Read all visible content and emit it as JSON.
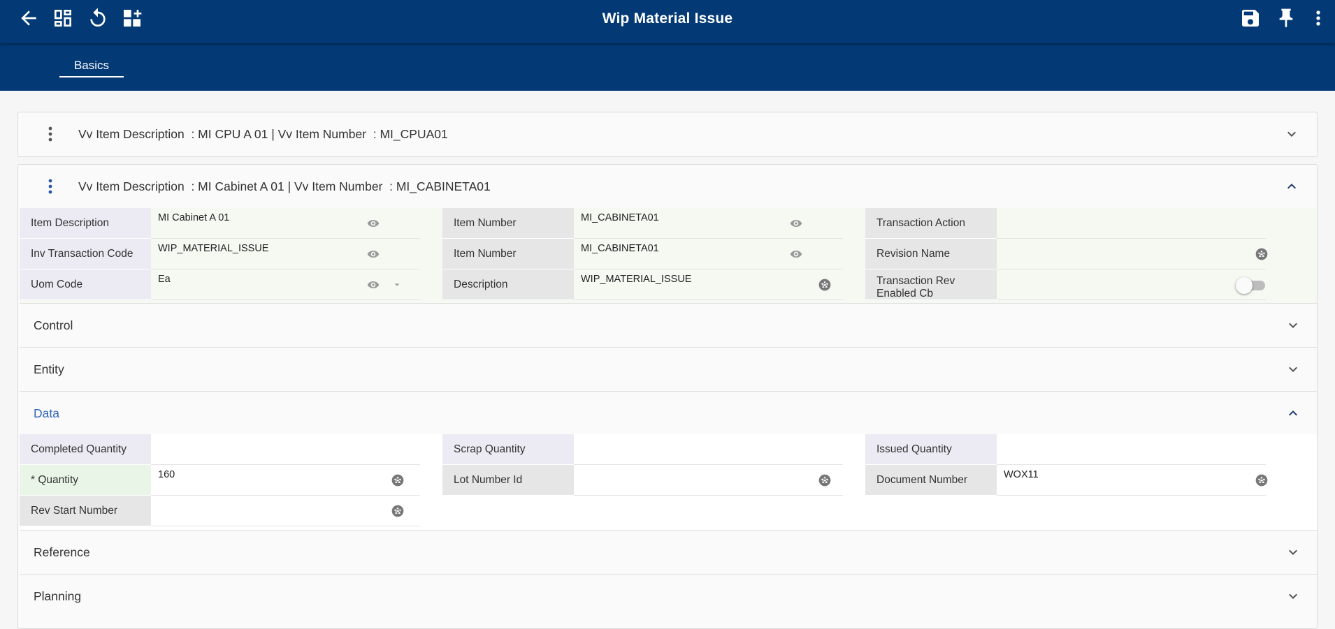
{
  "header": {
    "title": "Wip Material Issue",
    "tab_label": "Basics"
  },
  "panel1": {
    "title": "Vv Item Description  : MI CPU A 01 | Vv Item Number  : MI_CPUA01"
  },
  "panel2": {
    "title": "Vv Item Description  : MI Cabinet A 01 | Vv Item Number  : MI_CABINETA01",
    "fields": {
      "item_description": {
        "label": "Item Description",
        "value": "MI Cabinet A 01"
      },
      "inv_transaction_code": {
        "label": "Inv Transaction Code",
        "value": "WIP_MATERIAL_ISSUE"
      },
      "uom_code": {
        "label": "Uom Code",
        "value": "Ea"
      },
      "item_number_1": {
        "label": "Item Number",
        "value": "MI_CABINETA01"
      },
      "item_number_2": {
        "label": "Item Number",
        "value": "MI_CABINETA01"
      },
      "description": {
        "label": "Description",
        "value": "WIP_MATERIAL_ISSUE"
      },
      "transaction_action": {
        "label": "Transaction Action",
        "value": ""
      },
      "revision_name": {
        "label": "Revision Name",
        "value": ""
      },
      "transaction_rev_enabled": {
        "label": "Transaction Rev Enabled Cb",
        "value": false
      }
    }
  },
  "sections": {
    "control": "Control",
    "entity": "Entity",
    "data": "Data",
    "reference": "Reference",
    "planning": "Planning"
  },
  "data_section": {
    "completed_quantity": {
      "label": "Completed Quantity",
      "value": ""
    },
    "quantity": {
      "label": "* Quantity",
      "value": "160"
    },
    "rev_start_number": {
      "label": "Rev Start Number",
      "value": ""
    },
    "scrap_quantity": {
      "label": "Scrap Quantity",
      "value": ""
    },
    "lot_number_id": {
      "label": "Lot Number Id",
      "value": ""
    },
    "issued_quantity": {
      "label": "Issued Quantity",
      "value": ""
    },
    "document_number": {
      "label": "Document Number",
      "value": "WOX11"
    }
  },
  "colors": {
    "header_bg": "#033a75",
    "accent": "#3366b8"
  }
}
